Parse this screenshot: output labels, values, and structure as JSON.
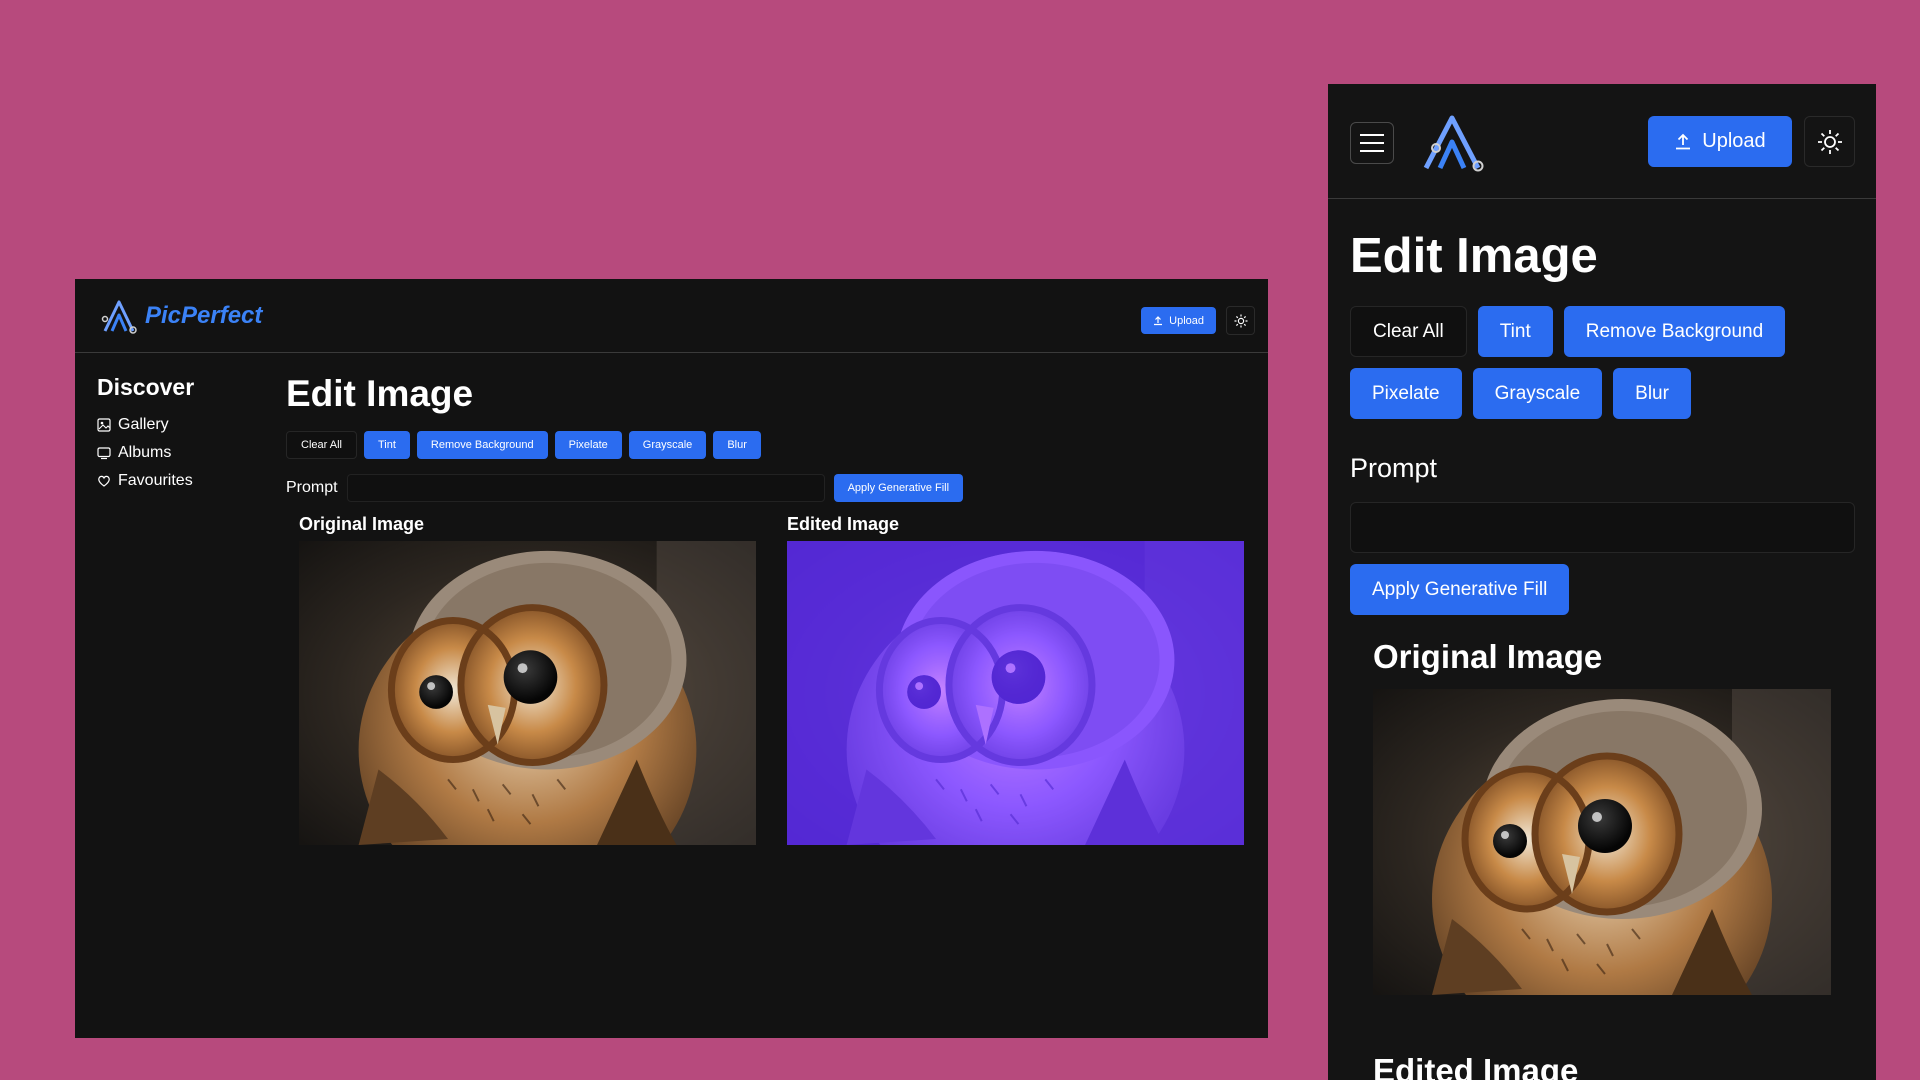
{
  "desktop": {
    "brand": "PicPerfect",
    "upload_label": "Upload",
    "sidebar": {
      "title": "Discover",
      "items": [
        {
          "label": "Gallery",
          "icon": "image-icon"
        },
        {
          "label": "Albums",
          "icon": "album-icon"
        },
        {
          "label": "Favourites",
          "icon": "heart-icon"
        }
      ]
    },
    "page_title": "Edit Image",
    "tools": [
      "Clear All",
      "Tint",
      "Remove Background",
      "Pixelate",
      "Grayscale",
      "Blur"
    ],
    "prompt_label": "Prompt",
    "prompt_value": "",
    "apply_label": "Apply Generative Fill",
    "original_title": "Original Image",
    "edited_title": "Edited Image"
  },
  "mobile": {
    "upload_label": "Upload",
    "page_title": "Edit Image",
    "tools": [
      "Clear All",
      "Tint",
      "Remove Background",
      "Pixelate",
      "Grayscale",
      "Blur"
    ],
    "prompt_label": "Prompt",
    "prompt_value": "",
    "apply_label": "Apply Generative Fill",
    "original_title": "Original Image",
    "edited_title": "Edited Image"
  },
  "colors": {
    "background": "#b74a7d",
    "panel": "#121212",
    "accent": "#2b6cf0",
    "brand": "#3b82f6",
    "tint": "#3a22ff"
  }
}
